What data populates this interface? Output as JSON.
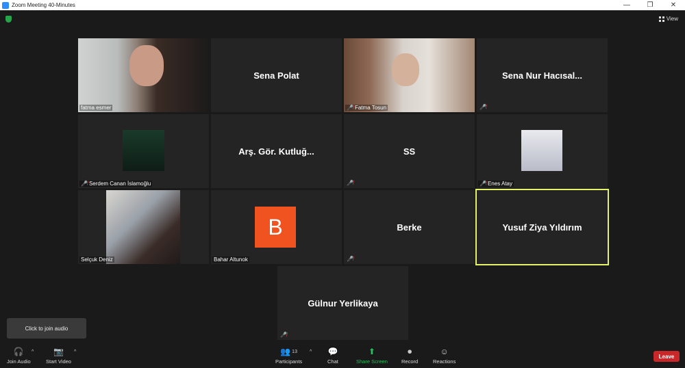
{
  "window": {
    "title": "Zoom Meeting 40-Minutes",
    "minimize": "—",
    "maximize": "❐",
    "close": "✕"
  },
  "view": {
    "label": "View"
  },
  "tiles": {
    "t1": {
      "name": "fatma esmer"
    },
    "t2": {
      "name": "Sena Polat"
    },
    "t3": {
      "name": "Fatma Tosun"
    },
    "t4": {
      "name": "Sena Nur Hacısal..."
    },
    "t5": {
      "name": "Serdem Canan İslamoğlu"
    },
    "t6": {
      "name": "Arş. Gör. Kutluğ..."
    },
    "t7": {
      "name": "SS"
    },
    "t8": {
      "name": "Enes Atay"
    },
    "t9": {
      "name": "Selçuk Deniz"
    },
    "t10": {
      "name": "Bahar Altunok",
      "avatar_letter": "B",
      "avatar_color": "#f0531f"
    },
    "t11": {
      "name": "Berke"
    },
    "t12": {
      "name": "Yusuf Ziya Yıldırım",
      "active_color": "#e4f36a"
    },
    "t13": {
      "name": "Gülnur Yerlikaya"
    }
  },
  "toast": {
    "text": "Click to join audio"
  },
  "toolbar": {
    "join_audio": "Join Audio",
    "start_video": "Start Video",
    "participants": "Participants",
    "participants_count": "13",
    "chat": "Chat",
    "share_screen": "Share Screen",
    "record": "Record",
    "reactions": "Reactions",
    "leave": "Leave"
  },
  "colors": {
    "background": "#1a1a1a",
    "tile": "#242424",
    "share": "#23c25a",
    "leave": "#c8282a"
  }
}
